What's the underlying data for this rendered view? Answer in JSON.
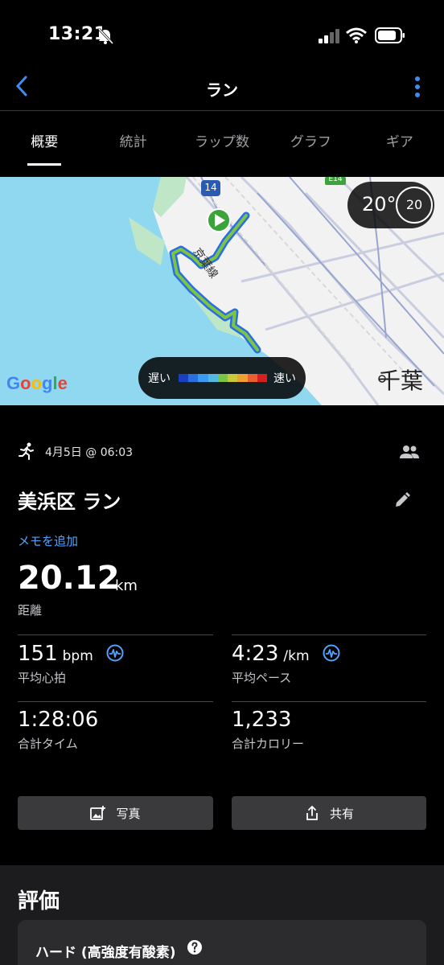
{
  "status_bar": {
    "time": "13:21"
  },
  "header": {
    "title": "ラン"
  },
  "tabs": [
    {
      "label": "概要",
      "active": true
    },
    {
      "label": "統計",
      "active": false
    },
    {
      "label": "ラップ数",
      "active": false
    },
    {
      "label": "グラフ",
      "active": false
    },
    {
      "label": "ギア",
      "active": false
    }
  ],
  "map": {
    "route_badge": "14",
    "expressway_badge": "E14",
    "line_label": "京葉線",
    "city_label": "千葉",
    "provider": "Google",
    "temperature": "20°",
    "wind_speed": "20",
    "legend_slow": "遅い",
    "legend_fast": "速い",
    "legend_colors": [
      "#1a3fbf",
      "#2a6fe0",
      "#3b9bf0",
      "#55b8e0",
      "#7cc444",
      "#c8c83a",
      "#f0a030",
      "#e86030",
      "#d42020"
    ]
  },
  "activity": {
    "date": "4月5日 @ 06:03",
    "name": "美浜区 ラン",
    "add_memo": "メモを追加",
    "distance": {
      "value": "20.12",
      "unit": "km",
      "label": "距離"
    }
  },
  "stats": {
    "heart_rate": {
      "value": "151",
      "unit": "bpm",
      "label": "平均心拍"
    },
    "pace": {
      "value": "4:23",
      "unit": "/km",
      "label": "平均ペース"
    },
    "total_time": {
      "value": "1:28:06",
      "label": "合計タイム"
    },
    "calories": {
      "value": "1,233",
      "label": "合計カロリー"
    }
  },
  "actions": {
    "photo": "写真",
    "share": "共有"
  },
  "rating": {
    "title": "評価",
    "level": "ハード (高強度有酸素)"
  },
  "colors": {
    "accent": "#4fa3ff",
    "route_green": "#7cc444",
    "map_water": "#8fd8ef"
  }
}
